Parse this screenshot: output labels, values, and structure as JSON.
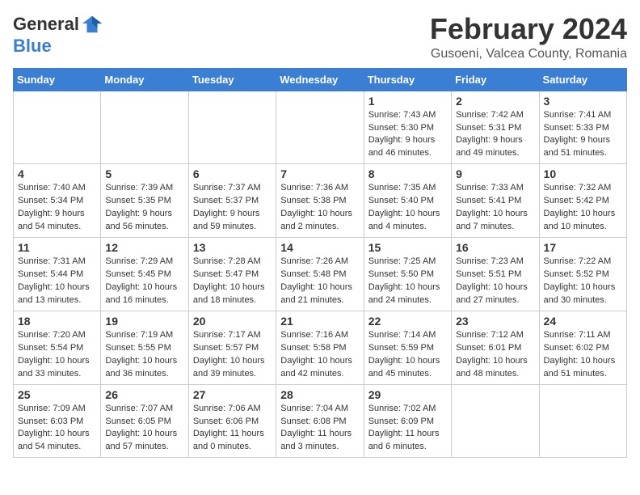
{
  "header": {
    "logo_general": "General",
    "logo_blue": "Blue",
    "month_title": "February 2024",
    "location": "Gusoeni, Valcea County, Romania"
  },
  "weekdays": [
    "Sunday",
    "Monday",
    "Tuesday",
    "Wednesday",
    "Thursday",
    "Friday",
    "Saturday"
  ],
  "weeks": [
    [
      {
        "day": "",
        "info": ""
      },
      {
        "day": "",
        "info": ""
      },
      {
        "day": "",
        "info": ""
      },
      {
        "day": "",
        "info": ""
      },
      {
        "day": "1",
        "info": "Sunrise: 7:43 AM\nSunset: 5:30 PM\nDaylight: 9 hours\nand 46 minutes."
      },
      {
        "day": "2",
        "info": "Sunrise: 7:42 AM\nSunset: 5:31 PM\nDaylight: 9 hours\nand 49 minutes."
      },
      {
        "day": "3",
        "info": "Sunrise: 7:41 AM\nSunset: 5:33 PM\nDaylight: 9 hours\nand 51 minutes."
      }
    ],
    [
      {
        "day": "4",
        "info": "Sunrise: 7:40 AM\nSunset: 5:34 PM\nDaylight: 9 hours\nand 54 minutes."
      },
      {
        "day": "5",
        "info": "Sunrise: 7:39 AM\nSunset: 5:35 PM\nDaylight: 9 hours\nand 56 minutes."
      },
      {
        "day": "6",
        "info": "Sunrise: 7:37 AM\nSunset: 5:37 PM\nDaylight: 9 hours\nand 59 minutes."
      },
      {
        "day": "7",
        "info": "Sunrise: 7:36 AM\nSunset: 5:38 PM\nDaylight: 10 hours\nand 2 minutes."
      },
      {
        "day": "8",
        "info": "Sunrise: 7:35 AM\nSunset: 5:40 PM\nDaylight: 10 hours\nand 4 minutes."
      },
      {
        "day": "9",
        "info": "Sunrise: 7:33 AM\nSunset: 5:41 PM\nDaylight: 10 hours\nand 7 minutes."
      },
      {
        "day": "10",
        "info": "Sunrise: 7:32 AM\nSunset: 5:42 PM\nDaylight: 10 hours\nand 10 minutes."
      }
    ],
    [
      {
        "day": "11",
        "info": "Sunrise: 7:31 AM\nSunset: 5:44 PM\nDaylight: 10 hours\nand 13 minutes."
      },
      {
        "day": "12",
        "info": "Sunrise: 7:29 AM\nSunset: 5:45 PM\nDaylight: 10 hours\nand 16 minutes."
      },
      {
        "day": "13",
        "info": "Sunrise: 7:28 AM\nSunset: 5:47 PM\nDaylight: 10 hours\nand 18 minutes."
      },
      {
        "day": "14",
        "info": "Sunrise: 7:26 AM\nSunset: 5:48 PM\nDaylight: 10 hours\nand 21 minutes."
      },
      {
        "day": "15",
        "info": "Sunrise: 7:25 AM\nSunset: 5:50 PM\nDaylight: 10 hours\nand 24 minutes."
      },
      {
        "day": "16",
        "info": "Sunrise: 7:23 AM\nSunset: 5:51 PM\nDaylight: 10 hours\nand 27 minutes."
      },
      {
        "day": "17",
        "info": "Sunrise: 7:22 AM\nSunset: 5:52 PM\nDaylight: 10 hours\nand 30 minutes."
      }
    ],
    [
      {
        "day": "18",
        "info": "Sunrise: 7:20 AM\nSunset: 5:54 PM\nDaylight: 10 hours\nand 33 minutes."
      },
      {
        "day": "19",
        "info": "Sunrise: 7:19 AM\nSunset: 5:55 PM\nDaylight: 10 hours\nand 36 minutes."
      },
      {
        "day": "20",
        "info": "Sunrise: 7:17 AM\nSunset: 5:57 PM\nDaylight: 10 hours\nand 39 minutes."
      },
      {
        "day": "21",
        "info": "Sunrise: 7:16 AM\nSunset: 5:58 PM\nDaylight: 10 hours\nand 42 minutes."
      },
      {
        "day": "22",
        "info": "Sunrise: 7:14 AM\nSunset: 5:59 PM\nDaylight: 10 hours\nand 45 minutes."
      },
      {
        "day": "23",
        "info": "Sunrise: 7:12 AM\nSunset: 6:01 PM\nDaylight: 10 hours\nand 48 minutes."
      },
      {
        "day": "24",
        "info": "Sunrise: 7:11 AM\nSunset: 6:02 PM\nDaylight: 10 hours\nand 51 minutes."
      }
    ],
    [
      {
        "day": "25",
        "info": "Sunrise: 7:09 AM\nSunset: 6:03 PM\nDaylight: 10 hours\nand 54 minutes."
      },
      {
        "day": "26",
        "info": "Sunrise: 7:07 AM\nSunset: 6:05 PM\nDaylight: 10 hours\nand 57 minutes."
      },
      {
        "day": "27",
        "info": "Sunrise: 7:06 AM\nSunset: 6:06 PM\nDaylight: 11 hours\nand 0 minutes."
      },
      {
        "day": "28",
        "info": "Sunrise: 7:04 AM\nSunset: 6:08 PM\nDaylight: 11 hours\nand 3 minutes."
      },
      {
        "day": "29",
        "info": "Sunrise: 7:02 AM\nSunset: 6:09 PM\nDaylight: 11 hours\nand 6 minutes."
      },
      {
        "day": "",
        "info": ""
      },
      {
        "day": "",
        "info": ""
      }
    ]
  ]
}
